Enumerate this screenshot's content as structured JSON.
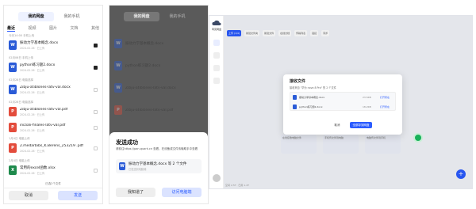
{
  "phone1": {
    "segments": [
      "我的网盘",
      "我的手机"
    ],
    "tabs": [
      "最近",
      "视频",
      "图片",
      "文档",
      "其他"
    ],
    "sections": [
      "今天14:00 手机上传",
      "02月06日 手机上传",
      "02月28日 电脑选择",
      "02月26日 电脑选择",
      "1月4日 电脑上传",
      "2月4日 电脑上传"
    ],
    "files": [
      {
        "name": "振动力学基本概念.docx",
        "meta": "2024-02-26 · 已上传",
        "type": "W",
        "checked": true
      },
      {
        "name": "python练习题2.docx",
        "meta": "2024-02-26 · 已上传",
        "type": "W",
        "checked": true
      },
      {
        "name": "Zibju-atiblones-latv-val.docx",
        "meta": "2024-02-26 · 已上传",
        "type": "W",
        "checked": false
      },
      {
        "name": "Zibju-atiblones-latv-val.pdf",
        "meta": "2024-02-26 · 已上传",
        "type": "PDF",
        "checked": false
      },
      {
        "name": "iniziali-finales-latv-val.pdf",
        "meta": "2024-02-26 · 已上传",
        "type": "PDF",
        "checked": false
      },
      {
        "name": "2.medarbibs_K.Berens_253219 .pdf",
        "meta": "2024-02-26 · 已上传",
        "type": "PDF",
        "checked": false
      },
      {
        "name": "常用的excel函数.xlsx",
        "meta": "2024-02-26 · 已上传",
        "type": "X",
        "checked": false
      }
    ],
    "selected_text": "已选2个文件",
    "cancel": "取消",
    "send": "发送"
  },
  "phone2": {
    "segments": [
      "我的网盘",
      "我的手机"
    ],
    "file_names": [
      "振动力学基本概念.docx",
      "python练习题2.docx",
      "Zibju-atiblones-latv-val.docx",
      "Zibju-atiblones-latv-val.pdf"
    ],
    "sheet_title": "发送成功",
    "sheet_desc": "请前往https://pan.quark.cn 查看，在设备或文件传输助手中查看",
    "sheet_link": "查看",
    "card_name": "振动力学基本概念.docx 等 2 个文件",
    "card_sub": "已发送到电脑端",
    "know": "我知道了",
    "visit": "访问电脑端"
  },
  "pc": {
    "brand": "夸克网盘",
    "toolbar": [
      "上传 (1/4)",
      "新建文件夹",
      "新建文件",
      "在线文档",
      "传输列表",
      "链接",
      "同步"
    ],
    "cards": [
      "在线接收电脑文件",
      "手机传文件到电脑",
      "电脑传文件到手机"
    ],
    "bottom": "空间 2.5T · 已用 1.4T",
    "dialog": {
      "title": "接收文件",
      "subtitle": "接收来自 \"华为 nova 8 Pro\" 的 2 个文件",
      "files": [
        {
          "name": "振动力学基本概念.docx",
          "size": "23.5KB",
          "op": "打开所在"
        },
        {
          "name": "python练习题2.docx",
          "size": "18.2KB",
          "op": "打开所在"
        }
      ],
      "cancel": "取消",
      "ok": "全部存到网盘"
    }
  }
}
